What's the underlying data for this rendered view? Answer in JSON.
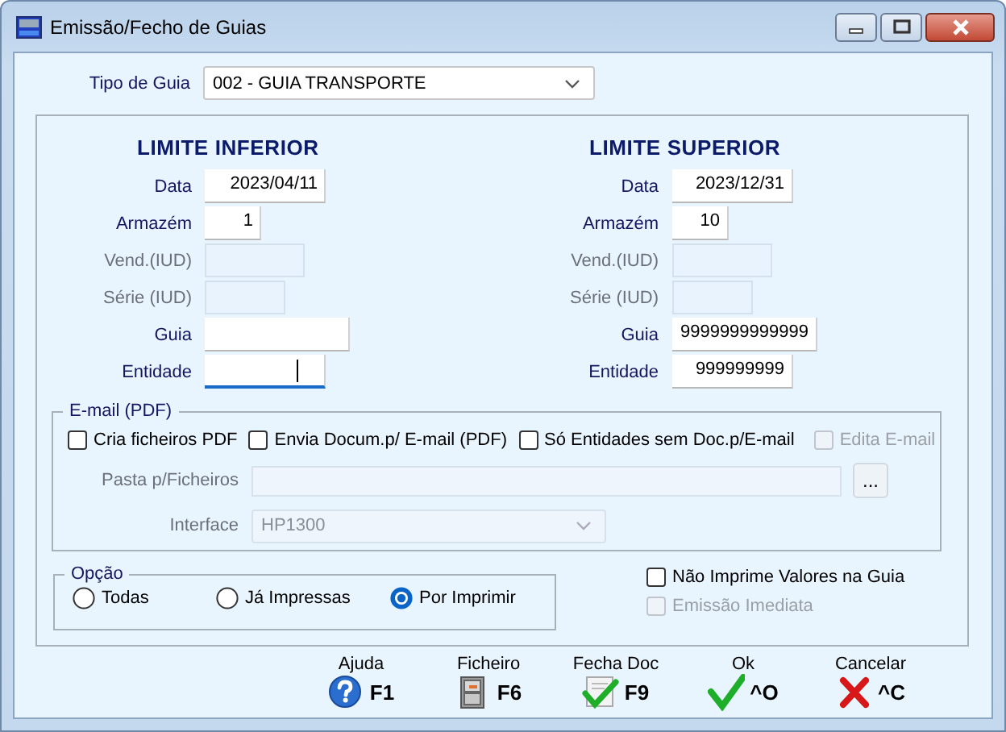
{
  "window": {
    "title": "Emissão/Fecho de Guias"
  },
  "tipo_guia": {
    "label": "Tipo de Guia",
    "value": "002 - GUIA TRANSPORTE"
  },
  "limits": [
    {
      "title": "LIMITE INFERIOR",
      "fields": [
        {
          "label": "Data",
          "value": "2023/04/11",
          "disabled": false,
          "focused": false
        },
        {
          "label": "Armazém",
          "value": "1",
          "disabled": false,
          "focused": false
        },
        {
          "label": "Vend.(IUD)",
          "disabled": true,
          "focused": false
        },
        {
          "label": "Série (IUD)",
          "disabled": true,
          "focused": false
        },
        {
          "label": "Guia",
          "disabled": false,
          "focused": false
        },
        {
          "label": "Entidade",
          "disabled": false,
          "focused": true
        }
      ]
    },
    {
      "title": "LIMITE SUPERIOR",
      "fields": [
        {
          "label": "Data",
          "value": "2023/12/31",
          "disabled": false,
          "focused": false
        },
        {
          "label": "Armazém",
          "value": "10",
          "disabled": false,
          "focused": false
        },
        {
          "label": "Vend.(IUD)",
          "disabled": true,
          "focused": false
        },
        {
          "label": "Série (IUD)",
          "disabled": true,
          "focused": false
        },
        {
          "label": "Guia",
          "value": "9999999999999",
          "disabled": false,
          "focused": false
        },
        {
          "label": "Entidade",
          "value": "999999999",
          "disabled": false,
          "focused": false
        }
      ]
    }
  ],
  "email": {
    "legend": "E-mail (PDF)",
    "checkboxes": [
      {
        "label": "Cria ficheiros PDF",
        "checked": false,
        "disabled": false
      },
      {
        "label": "Envia Docum.p/ E-mail (PDF)",
        "checked": false,
        "disabled": false
      },
      {
        "label": "Só Entidades sem Doc.p/E-mail",
        "checked": false,
        "disabled": false
      },
      {
        "label": "Edita E-mail",
        "checked": false,
        "disabled": true
      }
    ],
    "folder": {
      "label": "Pasta p/Ficheiros",
      "disabled": true,
      "browse": "..."
    },
    "interface": {
      "label": "Interface",
      "value": "HP1300",
      "disabled": true
    }
  },
  "opcao": {
    "legend": "Opção",
    "options": [
      {
        "label": "Todas",
        "selected": false
      },
      {
        "label": "Já Impressas",
        "selected": false
      },
      {
        "label": "Por Imprimir",
        "selected": true
      }
    ]
  },
  "options": [
    {
      "label": "Não Imprime Valores na Guia",
      "checked": false,
      "disabled": false
    },
    {
      "label": "Emissão Imediata",
      "checked": false,
      "disabled": true
    }
  ],
  "toolbar": [
    {
      "label": "Ajuda",
      "key": "F1",
      "kind": "help"
    },
    {
      "label": "Ficheiro",
      "key": "F6",
      "kind": "file"
    },
    {
      "label": "Fecha Doc",
      "key": "F9",
      "kind": "closedoc"
    },
    {
      "label": "Ok",
      "key": "^O",
      "kind": "ok"
    },
    {
      "label": "Cancelar",
      "key": "^C",
      "kind": "cancel"
    }
  ]
}
